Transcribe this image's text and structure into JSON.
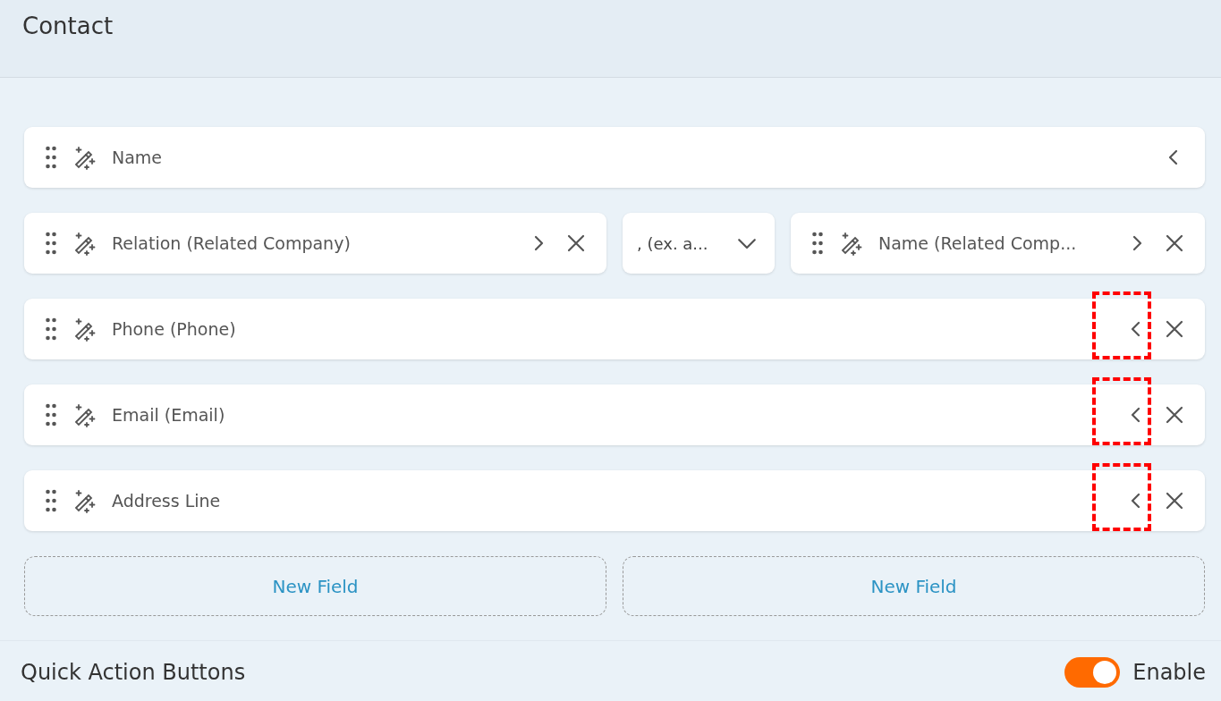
{
  "header": {
    "title": "Contact"
  },
  "rows": [
    {
      "items": [
        {
          "kind": "field",
          "label": "Name",
          "expanded": false,
          "removable": false,
          "highlighted": false
        }
      ]
    },
    {
      "items": [
        {
          "kind": "field",
          "label": "Relation (Related Company)",
          "expanded": true,
          "removable": true,
          "highlighted": false
        },
        {
          "kind": "separator",
          "label": ", (ex. a..."
        },
        {
          "kind": "field",
          "label": "Name (Related Comp...",
          "expanded": true,
          "removable": true,
          "highlighted": false
        }
      ]
    },
    {
      "items": [
        {
          "kind": "field",
          "label": "Phone (Phone)",
          "expanded": false,
          "removable": true,
          "highlighted": true
        }
      ]
    },
    {
      "items": [
        {
          "kind": "field",
          "label": "Email (Email)",
          "expanded": false,
          "removable": true,
          "highlighted": true
        }
      ]
    },
    {
      "items": [
        {
          "kind": "field",
          "label": "Address Line",
          "expanded": false,
          "removable": true,
          "highlighted": true
        }
      ]
    }
  ],
  "new_field_buttons": [
    "New Field",
    "New Field"
  ],
  "quick_actions": {
    "title": "Quick Action Buttons",
    "toggle_label": "Enable",
    "on": true
  }
}
